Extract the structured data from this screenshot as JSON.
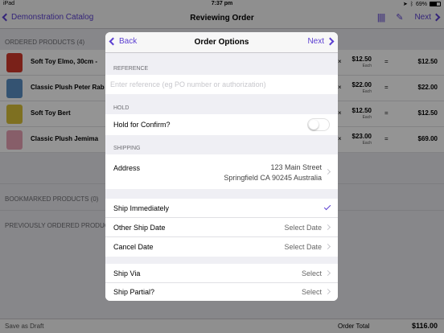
{
  "status_bar": {
    "device": "iPad",
    "time": "7:37 pm",
    "battery": "69%",
    "battery_level": 0.69
  },
  "nav": {
    "back_label": "Demonstration Catalog",
    "title": "Reviewing Order",
    "next_label": "Next"
  },
  "background": {
    "ordered_header": "ORDERED PRODUCTS (4)",
    "products": [
      {
        "name": "Soft Toy Elmo, 30cm -",
        "times": "×",
        "price": "$12.50",
        "each": "Each",
        "eq": "=",
        "total": "$12.50",
        "color": "#d23a2b"
      },
      {
        "name": "Classic Plush Peter Rab",
        "times": "×",
        "price": "$22.00",
        "each": "Each",
        "eq": "=",
        "total": "$22.00",
        "color": "#5a8fc4"
      },
      {
        "name": "Soft Toy  Bert",
        "times": "×",
        "price": "$12.50",
        "each": "Each",
        "eq": "=",
        "total": "$12.50",
        "color": "#d9c23a"
      },
      {
        "name": "Classic Plush Jemima",
        "times": "×",
        "price": "$23.00",
        "each": "Each",
        "eq": "=",
        "total": "$69.00",
        "color": "#e8a2b6"
      }
    ],
    "bookmarked_header": "BOOKMARKED PRODUCTS (0)",
    "previous_header": "PREVIOUSLY ORDERED PRODUCTS"
  },
  "bottom": {
    "draft_label": "Save as Draft",
    "order_total_label": "Order Total",
    "order_total_value": "$116.00"
  },
  "modal": {
    "back_label": "Back",
    "title": "Order Options",
    "next_label": "Next",
    "reference_header": "REFERENCE",
    "reference_placeholder": "Enter reference (eg PO number or authorization)",
    "hold_header": "HOLD",
    "hold_label": "Hold for Confirm?",
    "hold_on": false,
    "shipping_header": "SHIPPING",
    "address_label": "Address",
    "address_line1": "123 Main Street",
    "address_line2": "Springfield CA 90245 Australia",
    "ship_immediately": "Ship Immediately",
    "other_ship_date": "Other Ship Date",
    "other_ship_date_value": "Select Date",
    "cancel_date": "Cancel Date",
    "cancel_date_value": "Select Date",
    "ship_via": "Ship Via",
    "ship_via_value": "Select",
    "ship_partial": "Ship Partial?",
    "ship_partial_value": "Select"
  },
  "colors": {
    "accent": "#5b3fd1"
  }
}
